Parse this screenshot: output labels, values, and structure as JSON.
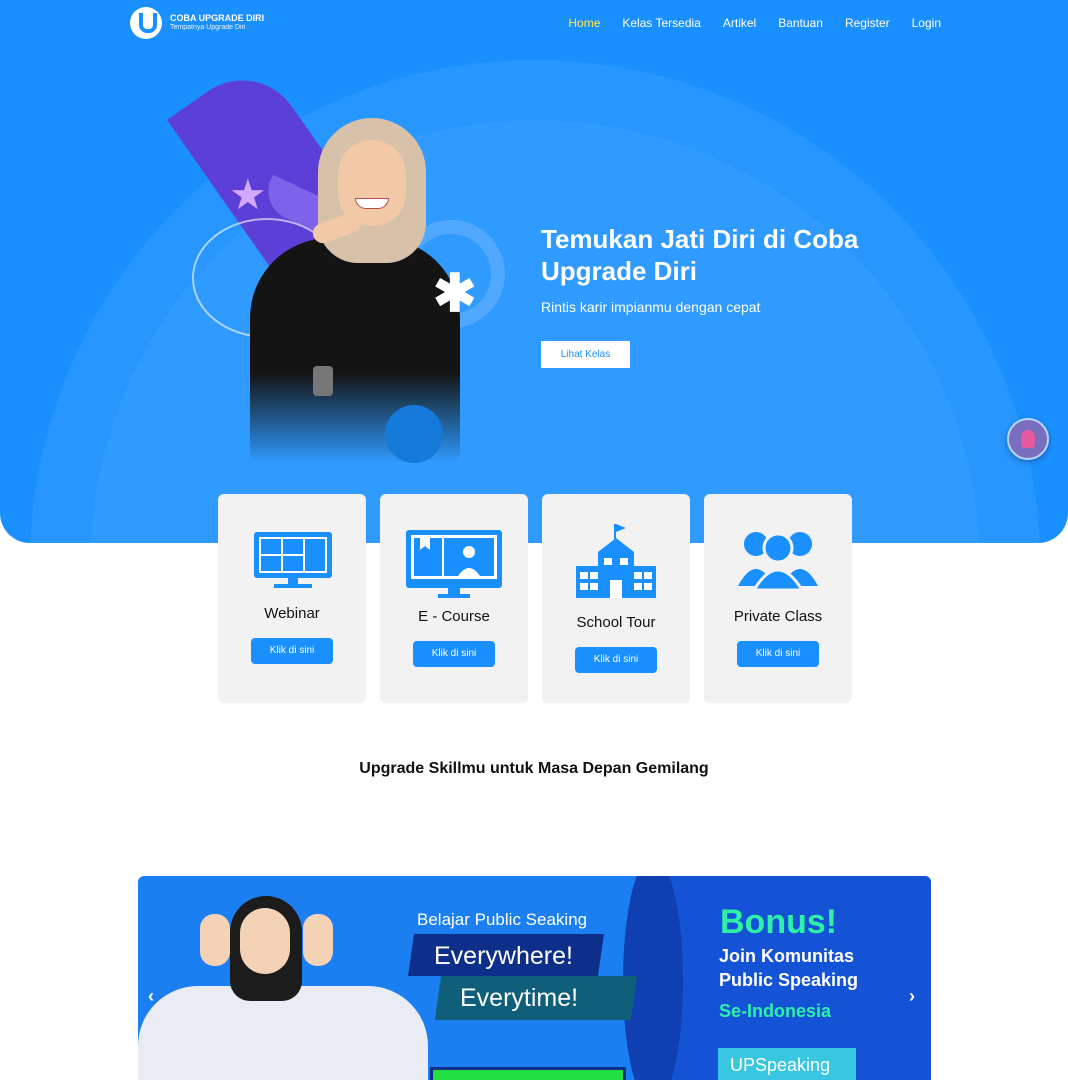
{
  "nav": {
    "logo_title": "COBA UPGRADE DIRI",
    "logo_sub": "Tempatnya Upgrade Diri",
    "items": [
      {
        "label": "Home",
        "active": true
      },
      {
        "label": "Kelas Tersedia"
      },
      {
        "label": "Artikel"
      },
      {
        "label": "Bantuan"
      },
      {
        "label": "Register"
      },
      {
        "label": "Login"
      }
    ]
  },
  "hero": {
    "title_plain": "Temukan ",
    "title_bold": "Jati Diri di Coba Upgrade Diri",
    "subtitle": "Rintis karir impianmu dengan cepat",
    "button": "Lihat Kelas"
  },
  "cards": [
    {
      "label": "Webinar",
      "button": "Klik di sini",
      "icon": "webinar-icon"
    },
    {
      "label": "E - Course",
      "button": "Klik di sini",
      "icon": "e-course-icon"
    },
    {
      "label": "School Tour",
      "button": "Klik di sini",
      "icon": "school-icon"
    },
    {
      "label": "Private Class",
      "button": "Klik di sini",
      "icon": "people-icon"
    }
  ],
  "section": {
    "title": "Upgrade Skillmu untuk Masa Depan Gemilang"
  },
  "banner": {
    "line1": "Belajar Public Seaking",
    "line2": "Everywhere!",
    "line3": "Everytime!",
    "bonus": "Bonus!",
    "join1": "Join Komunitas",
    "join2": "Public Speaking",
    "join3": "Se-Indonesia",
    "brand": "UPSpeaking",
    "prev": "‹",
    "next": "›"
  },
  "colors": {
    "primary": "#1a90ff",
    "active_nav": "#ffe94d",
    "card_bg": "#f2f2f2",
    "bonus_green": "#2ef0a8"
  }
}
